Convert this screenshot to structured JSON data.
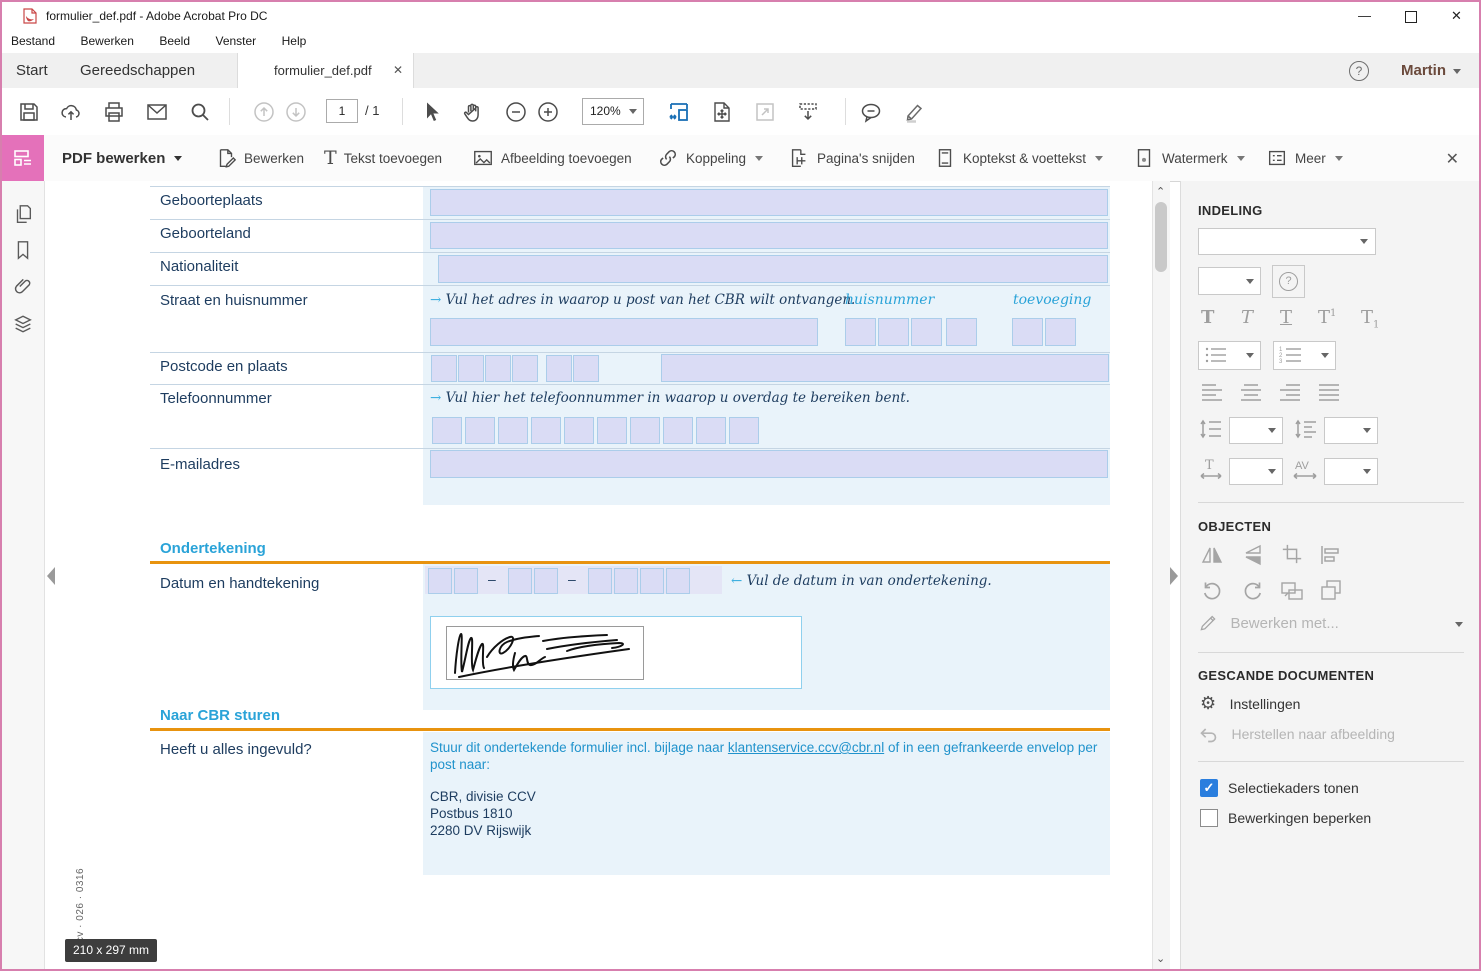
{
  "window": {
    "title": "formulier_def.pdf - Adobe Acrobat Pro DC"
  },
  "menubar": {
    "items": [
      "Bestand",
      "Bewerken",
      "Beeld",
      "Venster",
      "Help"
    ]
  },
  "tabbar": {
    "tabs": [
      "Start",
      "Gereedschappen"
    ],
    "doc_tab": "formulier_def.pdf",
    "user": "Martin",
    "help_glyph": "?"
  },
  "toolbar": {
    "page_current": "1",
    "page_total": "/ 1",
    "zoom_level": "120%"
  },
  "edit_toolbar": {
    "tool_label": "PDF bewerken",
    "items": [
      "Bewerken",
      "Tekst toevoegen",
      "Afbeelding toevoegen",
      "Koppeling",
      "Pagina's snijden",
      "Koptekst & voettekst",
      "Watermerk",
      "Meer"
    ]
  },
  "form": {
    "rows": [
      {
        "label": "Geboorteplaats"
      },
      {
        "label": "Geboorteland"
      },
      {
        "label": "Nationaliteit"
      }
    ],
    "straat": {
      "label": "Straat en huisnummer",
      "hint_arrow": "→",
      "hint": "Vul het adres in waarop u post van het CBR wilt ontvangen.",
      "col1": "huisnummer",
      "col2": "toevoeging"
    },
    "postcode": {
      "label": "Postcode en plaats"
    },
    "telefoon": {
      "label": "Telefoonnummer",
      "hint_arrow": "→",
      "hint": "Vul hier het telefoonnummer in waarop u overdag te bereiken bent."
    },
    "email": {
      "label": "E-mailadres"
    },
    "ondertekening": {
      "heading": "Ondertekening",
      "label": "Datum en handtekening",
      "separator": "–",
      "hint_arrow": "←",
      "hint": "Vul de datum in van ondertekening."
    },
    "naar_cbr": {
      "heading": "Naar CBR sturen",
      "label": "Heeft u alles ingevuld?",
      "text_before": "Stuur dit ondertekende formulier incl. bijlage naar ",
      "email_link": "klantenservice.ccv@cbr.nl",
      "text_after": " of in een gefrankeerde envelop per post naar:",
      "address": [
        "CBR, divisie CCV",
        "Postbus 1810",
        "2280 DV Rijswijk"
      ]
    },
    "vertical_code": "cv · 026 · 0316",
    "size_tooltip": "210 x 297 mm"
  },
  "right_panel": {
    "indeling": {
      "title": "INDELING"
    },
    "objecten": {
      "title": "OBJECTEN",
      "bewerken_met": "Bewerken met..."
    },
    "gescand": {
      "title": "GESCANDE DOCUMENTEN",
      "instellingen": "Instellingen",
      "herstellen": "Herstellen naar afbeelding"
    },
    "checkboxes": [
      {
        "label": "Selectiekaders tonen",
        "checked": true
      },
      {
        "label": "Bewerkingen beperken",
        "checked": false
      }
    ]
  },
  "colors": {
    "accent_pink": "#e471ba",
    "cyan": "#2aa3d8",
    "orange": "#e8930f",
    "navy": "#1d3c5f",
    "checkbox_blue": "#2a7ede",
    "link_blue": "#2193cc"
  }
}
